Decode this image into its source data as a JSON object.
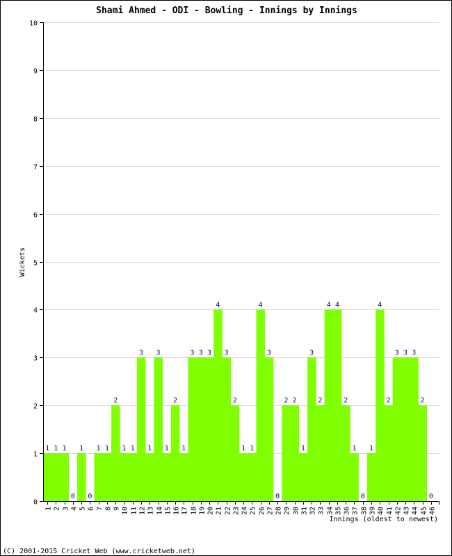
{
  "chart_data": {
    "type": "bar",
    "title": "Shami Ahmed - ODI - Bowling - Innings by Innings",
    "xlabel": "Innings (oldest to newest)",
    "ylabel": "Wickets",
    "ylim": [
      0,
      10
    ],
    "yticks": [
      0,
      1,
      2,
      3,
      4,
      5,
      6,
      7,
      8,
      9,
      10
    ],
    "grid": true,
    "bar_color": "#80ff00",
    "label_color": "#000080",
    "categories": [
      "1",
      "2",
      "3",
      "4",
      "5",
      "6",
      "7",
      "8",
      "9",
      "10",
      "11",
      "12",
      "13",
      "14",
      "15",
      "16",
      "17",
      "18",
      "19",
      "20",
      "21",
      "22",
      "23",
      "24",
      "25",
      "26",
      "27",
      "28",
      "29",
      "30",
      "31",
      "32",
      "33",
      "34",
      "35",
      "36",
      "37",
      "38",
      "39",
      "40",
      "41",
      "42",
      "43",
      "44",
      "45",
      "46"
    ],
    "values": [
      1,
      1,
      1,
      0,
      1,
      0,
      1,
      1,
      2,
      1,
      1,
      3,
      1,
      3,
      1,
      2,
      1,
      3,
      3,
      3,
      4,
      3,
      2,
      1,
      1,
      4,
      3,
      0,
      2,
      2,
      1,
      3,
      2,
      4,
      4,
      2,
      1,
      0,
      1,
      4,
      2,
      3,
      3,
      3,
      2,
      0
    ]
  },
  "footer": "(C) 2001-2015 Cricket Web (www.cricketweb.net)"
}
